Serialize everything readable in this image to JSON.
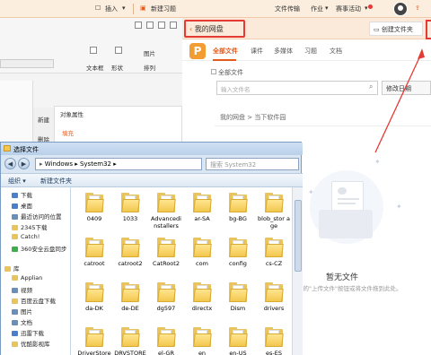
{
  "topbar": {
    "insert_label": "插入",
    "new_study_label": "新建习题",
    "file_transfer_label": "文件传输",
    "homework_label": "作业",
    "events_label": "赛事活动"
  },
  "wps": {
    "ribbon": {
      "textbox_label": "文本框",
      "shape_label": "形状",
      "image_label": "图片",
      "rearrange_label": "排列"
    },
    "left_items": [
      "新建",
      "删除"
    ],
    "properties_title": "对象属性",
    "properties_tab": "填充"
  },
  "cloud": {
    "title": "我的网盘",
    "create_folder_label": "创建文件夹",
    "tabs": [
      "全部文件",
      "课件",
      "多媒体",
      "习题",
      "文档"
    ],
    "all_files_checkbox_label": "全部文件",
    "search_placeholder": "输入文件名",
    "sort_label": "修改日期",
    "breadcrumb": "我的网盘 > 当下软件园",
    "empty_title": "暂无文件",
    "empty_hint": "角的\"上传文件\"按钮或将文件拖到此处。"
  },
  "dialog": {
    "title": "选择文件",
    "address_path": "Windows ▸ System32 ▸",
    "search_placeholder": "搜索 System32",
    "toolbar": [
      "组织 ▾",
      "新建文件夹"
    ],
    "nav_items": [
      {
        "label": "下载",
        "color": "#4a7fcb"
      },
      {
        "label": "桌面",
        "color": "#4a7fcb"
      },
      {
        "label": "最近访问的位置",
        "color": "#6a8fb8"
      },
      {
        "label": "2345下载",
        "color": "#e9c35c"
      },
      {
        "label": "Catch!",
        "color": "#e9c35c"
      },
      {
        "label": "360安全云盘同步",
        "color": "#3cae4c"
      },
      {
        "label": "库",
        "color": "#e9c35c"
      },
      {
        "label": "Applian",
        "color": "#e9c35c"
      },
      {
        "label": "视频",
        "color": "#6a8fb8"
      },
      {
        "label": "百度云盘下载",
        "color": "#e9c35c"
      },
      {
        "label": "图片",
        "color": "#6a8fb8"
      },
      {
        "label": "文档",
        "color": "#6a8fb8"
      },
      {
        "label": "迅雷下载",
        "color": "#4a7fcb"
      },
      {
        "label": "优酷影视库",
        "color": "#e9c35c"
      }
    ],
    "folders": [
      [
        "0409",
        "1033",
        "Advancedi nstallers",
        "ar-SA",
        "bg-BG",
        "blob_stor age"
      ],
      [
        "catroot",
        "catroot2",
        "CatRoot2",
        "com",
        "config",
        "cs-CZ"
      ],
      [
        "da-DK",
        "de-DE",
        "dg597",
        "directx",
        "Dism",
        "drivers"
      ],
      [
        "DriverStore",
        "DRVSTORE",
        "el-GR",
        "en",
        "en-US",
        "es-ES"
      ]
    ]
  },
  "colors": {
    "accent": "#e25a1c",
    "highlight_box": "#e53935",
    "folder": "#f3c74f"
  }
}
